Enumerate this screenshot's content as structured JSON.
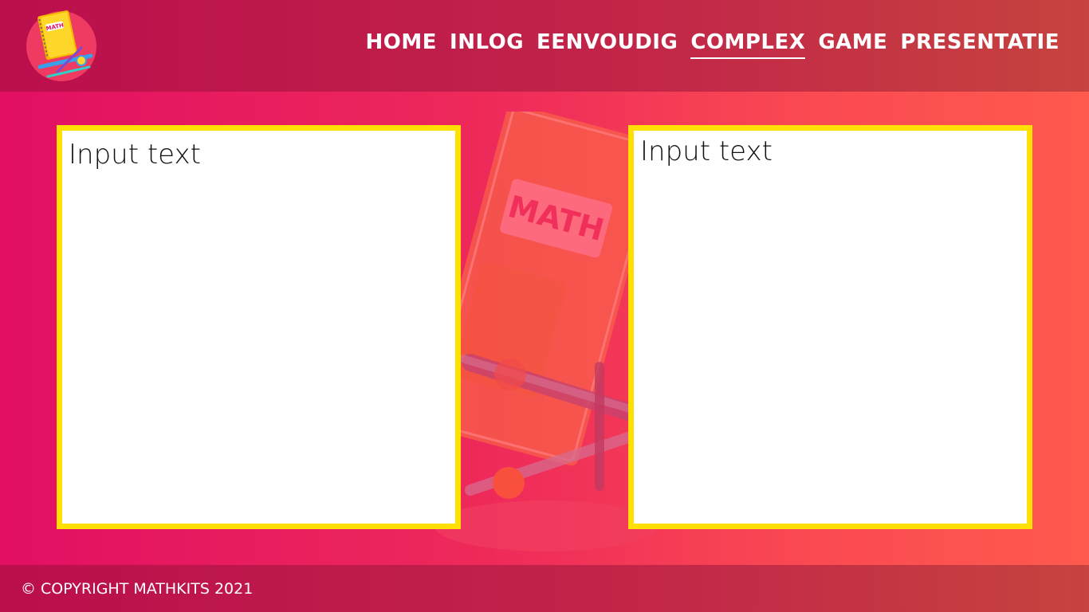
{
  "header": {
    "logo_label": "MATH",
    "nav": [
      {
        "label": "HOME",
        "active": false
      },
      {
        "label": "INLOG",
        "active": false
      },
      {
        "label": "EENVOUDIG",
        "active": false
      },
      {
        "label": "COMPLEX",
        "active": true
      },
      {
        "label": "GAME",
        "active": false
      },
      {
        "label": "PRESENTATIE",
        "active": false
      }
    ]
  },
  "background_art": {
    "label": "MATH"
  },
  "panels": {
    "left": {
      "placeholder": "Input text",
      "value": ""
    },
    "right": {
      "placeholder": "Input text",
      "value": ""
    }
  },
  "footer": {
    "copyright": "© COPYRIGHT MATHKITS 2021"
  },
  "colors": {
    "header_bg": "#bb0e4d",
    "page_bg_left": "#e20f63",
    "page_bg_right": "#ff5a4e",
    "panel_border": "#ffe000",
    "panel_bg": "#ffffff"
  }
}
